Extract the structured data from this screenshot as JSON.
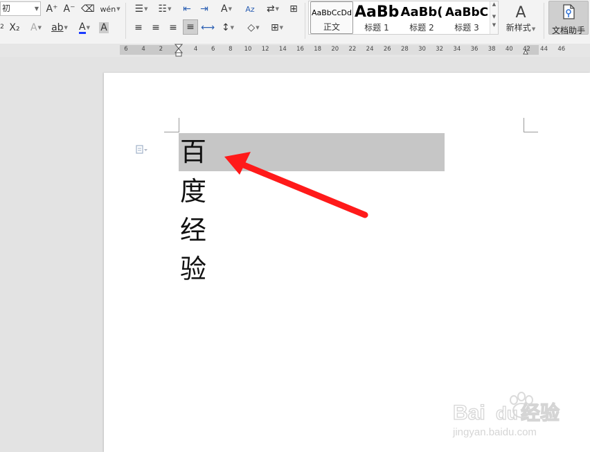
{
  "toolbar": {
    "font_name_value": "初",
    "grow_font_icon": "A⁺",
    "shrink_font_icon": "A⁻",
    "eraser_icon": "⌫",
    "pinyin_icon": "wén",
    "subscript_icon": "X₂",
    "superscript_marker": "2",
    "text_effect_icon": "A",
    "highlight_icon": "ab",
    "font_color_icon": "A",
    "char_shading_icon": "A",
    "bullets_icon": "☰",
    "numbering_icon": "☷",
    "decrease_indent_icon": "⇤",
    "increase_indent_icon": "⇥",
    "change_case_icon": "A",
    "sort_icon": "Az",
    "line_break_icon": "⇄",
    "border_icon": "⊞",
    "align_left_icon": "≡",
    "align_center_icon": "≡",
    "align_right_icon": "≡",
    "justify_icon": "≡",
    "distribute_icon": "⟷",
    "line_spacing_icon": "↕",
    "shading_icon": "◇",
    "borders_icon": "⊞"
  },
  "styles": {
    "items": [
      {
        "sample": "AaBbCcDd",
        "label": "正文"
      },
      {
        "sample": "AaBb",
        "label": "标题 1"
      },
      {
        "sample": "AaBb(",
        "label": "标题 2"
      },
      {
        "sample": "AaBbC",
        "label": "标题 3"
      }
    ],
    "new_style_label": "新样式",
    "new_style_icon": "A"
  },
  "assistant": {
    "label": "文档助手"
  },
  "ruler": {
    "ticks": [
      "6",
      "4",
      "2",
      "2",
      "4",
      "6",
      "8",
      "10",
      "12",
      "14",
      "16",
      "18",
      "20",
      "22",
      "24",
      "26",
      "28",
      "30",
      "32",
      "34",
      "36",
      "38",
      "40",
      "42",
      "44",
      "46"
    ]
  },
  "document": {
    "lines": [
      "百",
      "度",
      "经",
      "验"
    ]
  },
  "watermark": {
    "brand": "Bai",
    "brand_tail": "du",
    "suffix": "经验",
    "url": "jingyan.baidu.com"
  },
  "colors": {
    "arrow": "#ff1a1a",
    "selection": "#c6c6c6",
    "font_color_bar": "#1a3cff"
  }
}
